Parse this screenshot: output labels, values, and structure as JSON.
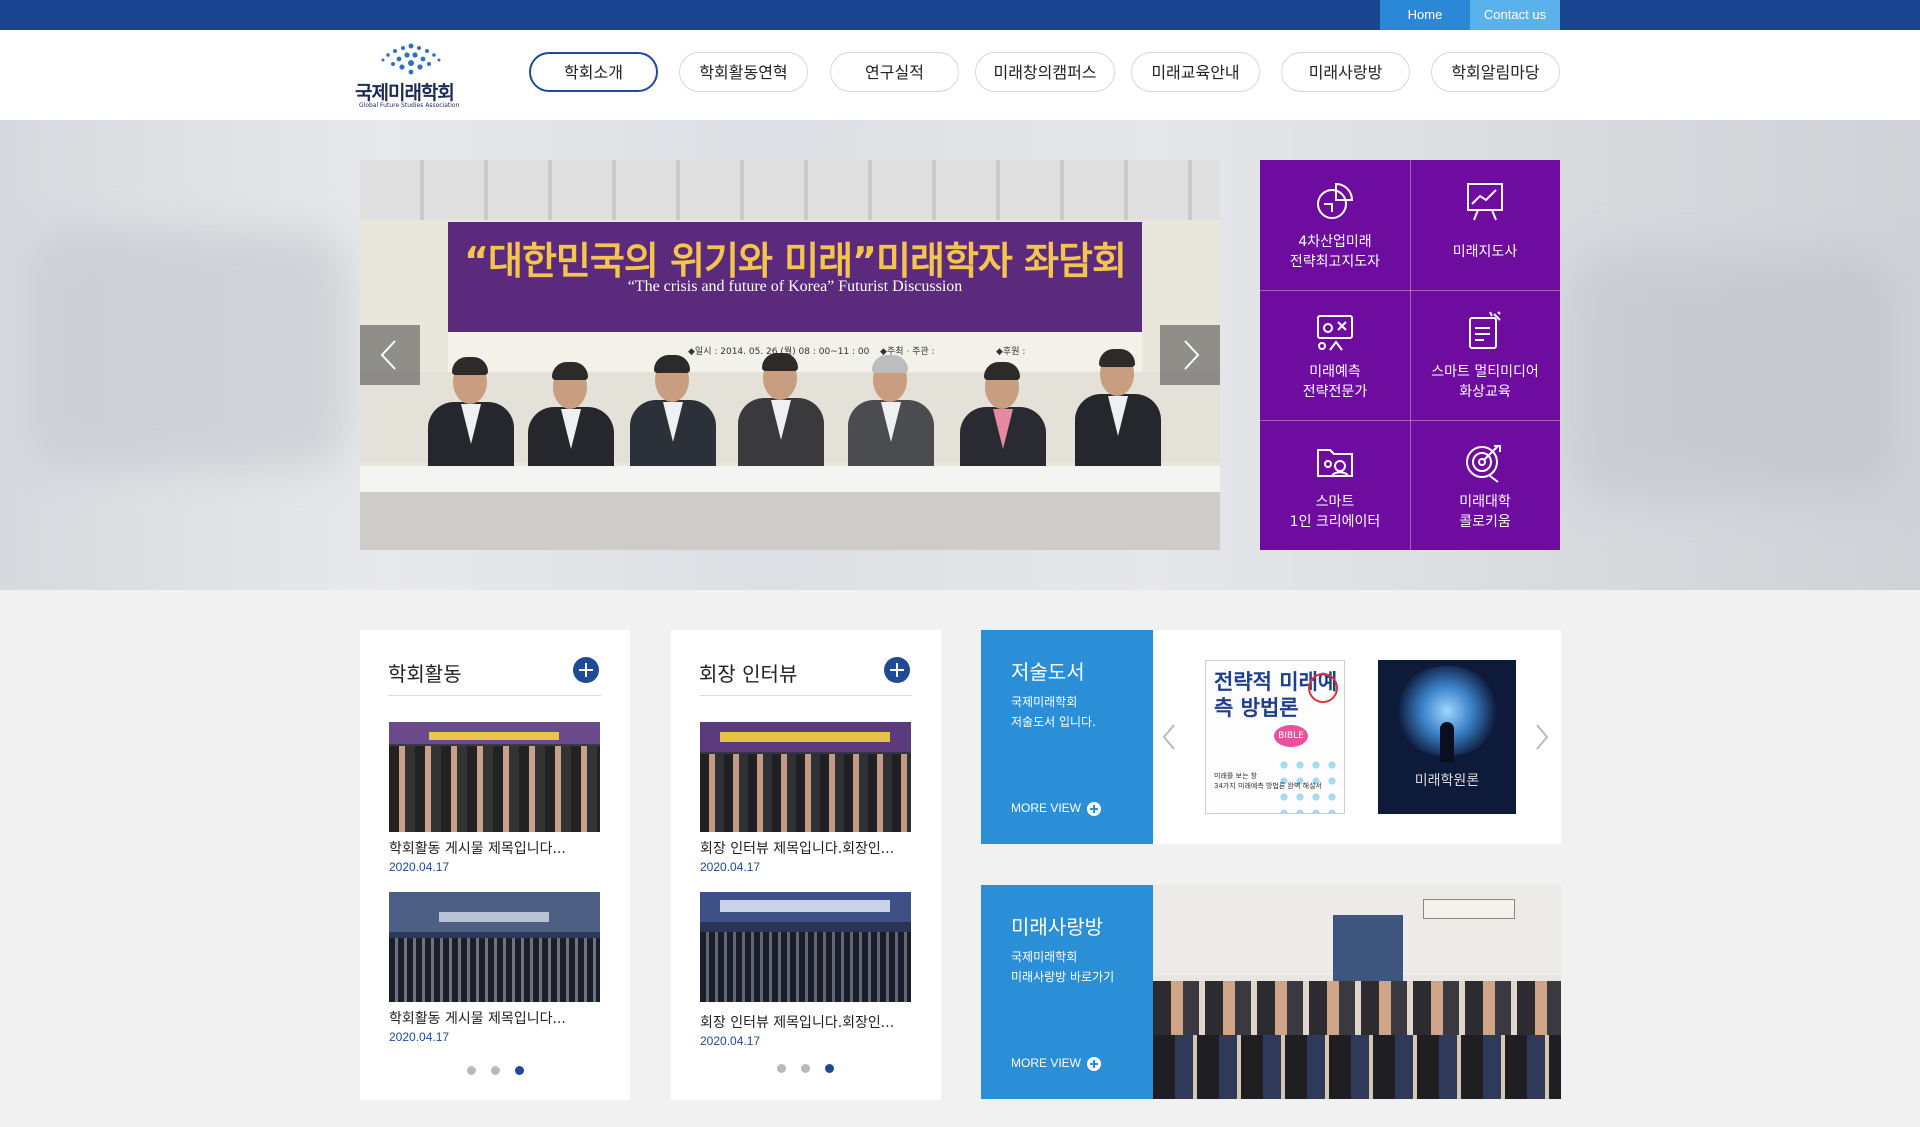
{
  "topbar": {
    "home": "Home",
    "contact": "Contact us"
  },
  "logo": {
    "name_ko": "국제미래학회",
    "name_en": "Global Future Studies Association"
  },
  "nav": [
    {
      "label": "학회소개",
      "active": true
    },
    {
      "label": "학회활동연혁"
    },
    {
      "label": "연구실적"
    },
    {
      "label": "미래창의캠퍼스"
    },
    {
      "label": "미래교육안내"
    },
    {
      "label": "미래사랑방"
    },
    {
      "label": "학회알림마당"
    }
  ],
  "slide": {
    "banner_title": "“대한민국의 위기와 미래”미래학자 좌담회",
    "banner_subtitle": "“The crisis and future of Korea” Futurist Discussion",
    "banner_date": "◆일시 : 2014. 05. 26 (월) 08 : 00~11 : 00",
    "banner_host": "◆주최 · 주관 :",
    "banner_sponsor": "◆후원 :"
  },
  "quick_links": [
    {
      "label1": "4차산업미래",
      "label2": "전략최고지도자",
      "icon": "pie-chart-icon"
    },
    {
      "label1": "미래지도사",
      "label2": "",
      "icon": "presentation-chart-icon"
    },
    {
      "label1": "미래예측",
      "label2": "전략전문가",
      "icon": "strategy-board-icon"
    },
    {
      "label1": "스마트 멀티미디어",
      "label2": "화상교육",
      "icon": "certificate-icon"
    },
    {
      "label1": "스마트",
      "label2": "1인 크리에이터",
      "icon": "creator-folder-icon"
    },
    {
      "label1": "미래대학",
      "label2": "콜로키움",
      "icon": "target-icon"
    }
  ],
  "activity": {
    "title": "학회활동",
    "posts": [
      {
        "title": "학회활동 게시물 제목입니다...",
        "date": "2020.04.17"
      },
      {
        "title": "학회활동 게시물 제목입니다...",
        "date": "2020.04.17"
      }
    ],
    "page_count": 3,
    "current_page": 3
  },
  "interview": {
    "title": "회장 인터뷰",
    "posts": [
      {
        "title": "회장 인터뷰 제목입니다.회장인...",
        "date": "2020.04.17"
      },
      {
        "title": "회장 인터뷰 제목입니다.회장인...",
        "date": "2020.04.17"
      }
    ],
    "page_count": 3,
    "current_page": 3
  },
  "books": {
    "title": "저술도서",
    "desc1": "국제미래학회",
    "desc2": "저술도서 입니다.",
    "more": "MORE VIEW",
    "book1_title": "전략적 미래예측 방법론",
    "book1_tag": "BIBLE",
    "book1_sub1": "미래를 보는 창",
    "book1_sub2": "34가지 미래예측 방법론 완벽 해설서",
    "book2_title": "미래학원론"
  },
  "love_room": {
    "title": "미래사랑방",
    "desc1": "국제미래학회",
    "desc2": "미래사랑방 바로가기",
    "more": "MORE VIEW"
  },
  "colors": {
    "topbar": "#1a4390",
    "accent": "#1e4a96",
    "purple": "#6d0c9e",
    "sky": "#2b8fd7"
  }
}
